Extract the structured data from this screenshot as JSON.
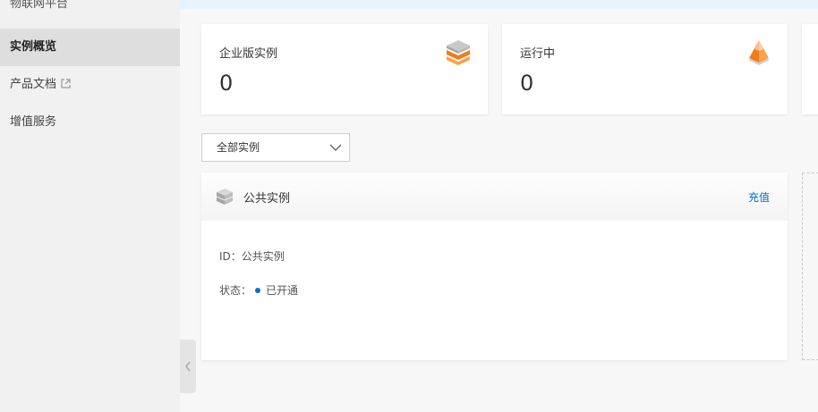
{
  "sidebar": {
    "title": "物联网平台",
    "items": [
      {
        "label": "实例概览",
        "active": true
      },
      {
        "label": "产品文档",
        "external": true
      },
      {
        "label": "增值服务"
      }
    ]
  },
  "stats": [
    {
      "label": "企业版实例",
      "value": "0",
      "icon": "stacked-cubes-icon"
    },
    {
      "label": "运行中",
      "value": "0",
      "icon": "running-pyramid-icon"
    }
  ],
  "filter": {
    "selected": "全部实例"
  },
  "instance": {
    "title": "公共实例",
    "action": "充值",
    "id_label": "ID：",
    "id_value": "公共实例",
    "status_label": "状态：",
    "status_value": "已开通"
  },
  "colors": {
    "accent": "#0070cc",
    "orange": "#f27b1a",
    "banner": "#e6f3fd"
  }
}
